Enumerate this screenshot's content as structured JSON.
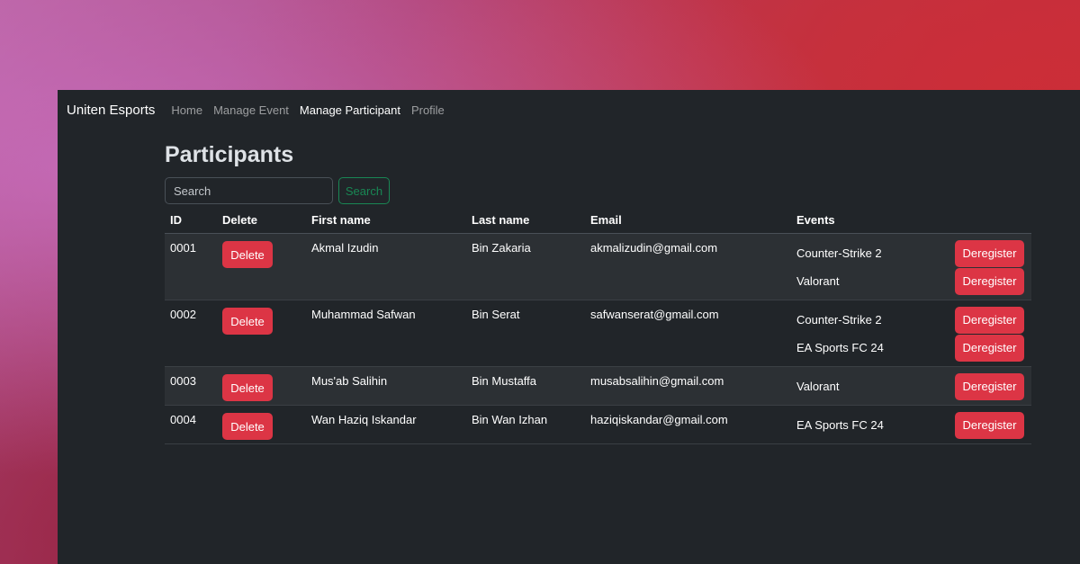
{
  "navbar": {
    "brand": "Uniten Esports",
    "links": [
      {
        "label": "Home",
        "active": false
      },
      {
        "label": "Manage Event",
        "active": false
      },
      {
        "label": "Manage Participant",
        "active": true
      },
      {
        "label": "Profile",
        "active": false
      }
    ]
  },
  "page": {
    "title": "Participants"
  },
  "search": {
    "placeholder": "Search",
    "button_label": "Search"
  },
  "table": {
    "headers": {
      "id": "ID",
      "delete": "Delete",
      "first_name": "First name",
      "last_name": "Last name",
      "email": "Email",
      "events": "Events"
    },
    "delete_label": "Delete",
    "deregister_label": "Deregister",
    "rows": [
      {
        "id": "0001",
        "first_name": "Akmal Izudin",
        "last_name": "Bin Zakaria",
        "email": "akmalizudin@gmail.com",
        "events": [
          "Counter-Strike 2",
          "Valorant"
        ]
      },
      {
        "id": "0002",
        "first_name": "Muhammad Safwan",
        "last_name": "Bin Serat",
        "email": "safwanserat@gmail.com",
        "events": [
          "Counter-Strike 2",
          "EA Sports FC 24"
        ]
      },
      {
        "id": "0003",
        "first_name": "Mus'ab Salihin",
        "last_name": "Bin Mustaffa",
        "email": "musabsalihin@gmail.com",
        "events": [
          "Valorant"
        ]
      },
      {
        "id": "0004",
        "first_name": "Wan Haziq Iskandar",
        "last_name": "Bin Wan Izhan",
        "email": "haziqiskandar@gmail.com",
        "events": [
          "EA Sports FC 24"
        ]
      }
    ]
  },
  "colors": {
    "background": "#212529",
    "danger": "#dc3545",
    "success": "#198754",
    "stripe": "#2c3034"
  }
}
